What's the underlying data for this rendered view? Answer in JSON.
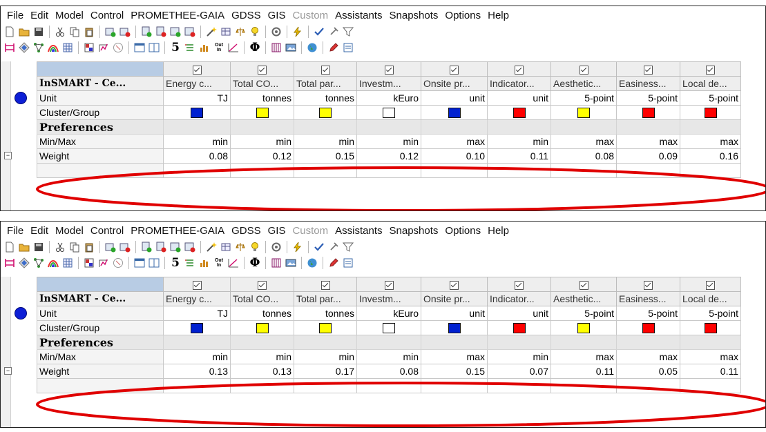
{
  "menu": [
    "File",
    "Edit",
    "Model",
    "Control",
    "PROMETHEE-GAIA",
    "GDSS",
    "GIS",
    "Custom",
    "Assistants",
    "Snapshots",
    "Options",
    "Help"
  ],
  "menu_disabled": [
    "Custom"
  ],
  "toolbar1_icons": [
    "new-file-icon",
    "open-folder-icon",
    "save-icon",
    "cut-icon",
    "copy-icon",
    "paste-icon",
    "add-action-icon",
    "remove-action-icon",
    "add-criterion-icon",
    "remove-criterion-icon",
    "add-scenario-icon",
    "remove-scenario-icon",
    "magic-wand-icon",
    "table-icon",
    "balance-icon",
    "lightbulb-icon",
    "settings-icon",
    "lightning-icon",
    "checkmark-icon",
    "pin-icon",
    "filter-icon"
  ],
  "toolbar2_icons": [
    "ranking-icon",
    "diamond-icon",
    "network-icon",
    "rainbow-icon",
    "grid-icon",
    "cluster-icon",
    "walking-weights-icon",
    "stop-icon",
    "window-icon",
    "split-icon",
    "number-icon",
    "list-icon",
    "chart-icon",
    "out-in-icon",
    "curve-icon",
    "phi-icon",
    "matrix-icon",
    "image-icon",
    "globe-icon",
    "pencil-icon",
    "notes-icon"
  ],
  "toolbar2_texts": {
    "number": "5",
    "phi": "Φ",
    "outin_top": "Out",
    "outin_bottom": "In"
  },
  "model_name": "InSMART - Ce...",
  "criteria": [
    "Energy c...",
    "Total CO...",
    "Total par...",
    "Investm...",
    "Onsite pr...",
    "Indicator...",
    "Aesthetic...",
    "Easiness...",
    "Local de..."
  ],
  "row_labels": {
    "unit": "Unit",
    "cluster": "Cluster/Group",
    "preferences": "Preferences",
    "minmax": "Min/Max",
    "weight": "Weight"
  },
  "units": [
    "TJ",
    "tonnes",
    "tonnes",
    "kEuro",
    "unit",
    "unit",
    "5-point",
    "5-point",
    "5-point"
  ],
  "cluster_colors": [
    "#0020d0",
    "#ffff00",
    "#ffff00",
    "#ffffff",
    "#0020d0",
    "#ff0000",
    "#ffff00",
    "#ff0000",
    "#ff0000"
  ],
  "minmax": [
    "min",
    "min",
    "min",
    "min",
    "max",
    "min",
    "max",
    "max",
    "max"
  ],
  "panels": [
    {
      "weights": [
        "0.08",
        "0.12",
        "0.15",
        "0.12",
        "0.10",
        "0.11",
        "0.08",
        "0.09",
        "0.16"
      ]
    },
    {
      "weights": [
        "0.13",
        "0.13",
        "0.17",
        "0.08",
        "0.15",
        "0.07",
        "0.11",
        "0.05",
        "0.11"
      ]
    }
  ],
  "highlight_color": "#e00000"
}
